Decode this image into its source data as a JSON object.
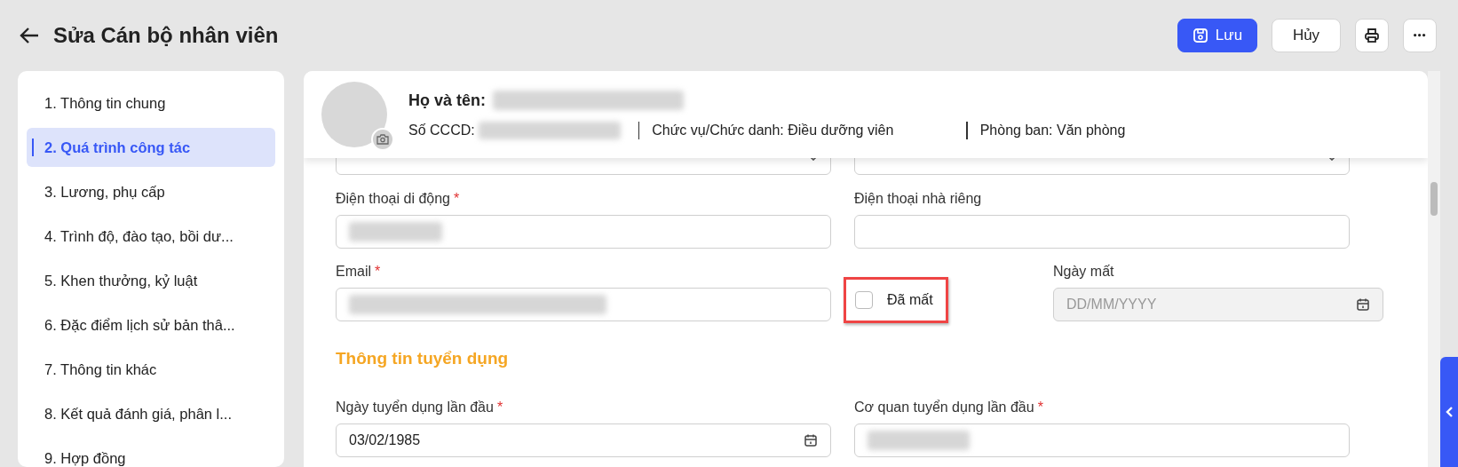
{
  "page_title": "Sửa Cán bộ nhân viên",
  "actions": [
    {
      "kind": "save",
      "label": "Lưu"
    },
    {
      "kind": "cancel",
      "label": "Hủy"
    },
    {
      "kind": "print"
    },
    {
      "kind": "more"
    }
  ],
  "sidebar": {
    "items": [
      {
        "label": "1. Thông tin chung",
        "selected": false
      },
      {
        "label": "2. Quá trình công tác",
        "selected": true
      },
      {
        "label": "3. Lương, phụ cấp",
        "selected": false
      },
      {
        "label": "4. Trình độ, đào tạo, bồi dư...",
        "selected": false
      },
      {
        "label": "5. Khen thưởng, kỷ luật",
        "selected": false
      },
      {
        "label": "6. Đặc điểm lịch sử bản thâ...",
        "selected": false
      },
      {
        "label": "7. Thông tin khác",
        "selected": false
      },
      {
        "label": "8. Kết quả đánh giá, phân l...",
        "selected": false
      },
      {
        "label": "9. Hợp đồng",
        "selected": false
      }
    ]
  },
  "profile": {
    "name_label": "Họ và tên:",
    "id_label": "Số CCCD:",
    "position": "Chức vụ/Chức danh: Điều dưỡng viên",
    "department": "Phòng ban: Văn phòng"
  },
  "form": {
    "rows": [
      {
        "fields": [
          {
            "kind": "select-cut"
          },
          {
            "kind": "select-cut"
          }
        ]
      },
      {
        "fields": [
          {
            "kind": "masked",
            "label": "Điện thoại di động",
            "required_mark": "*"
          },
          {
            "kind": "text",
            "label": "Điện thoại nhà riêng"
          }
        ]
      },
      {
        "fields": [
          {
            "kind": "masked",
            "label": "Email",
            "required_mark": "*"
          },
          {
            "kind": "checkbox",
            "label": "Đã mất",
            "checked": false,
            "highlighted": true
          },
          {
            "kind": "date",
            "label": "Ngày mất",
            "placeholder": "DD/MM/YYYY",
            "disabled": true
          }
        ]
      },
      {
        "fields": [
          {
            "kind": "section",
            "label": "Thông tin tuyển dụng"
          }
        ]
      },
      {
        "fields": [
          {
            "kind": "date",
            "label": "Ngày tuyển dụng lần đầu",
            "required_mark": "*",
            "value": "03/02/1985",
            "disabled": false
          },
          {
            "kind": "masked",
            "label": "Cơ quan tuyển dụng lần đầu",
            "required_mark": "*"
          }
        ]
      }
    ]
  }
}
